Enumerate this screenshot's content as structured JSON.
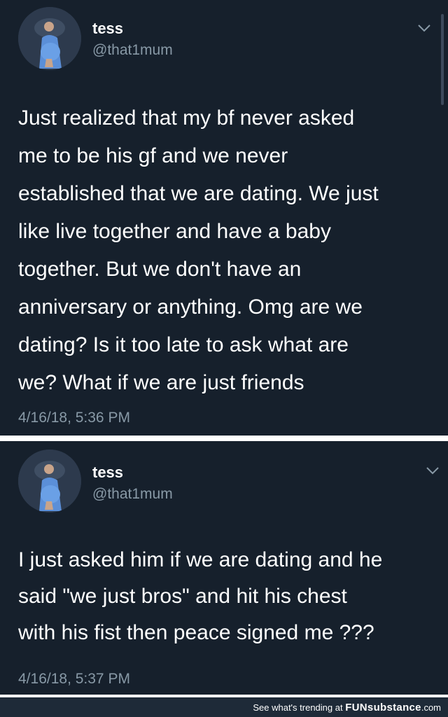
{
  "tweets": [
    {
      "name": "tess",
      "handle": "@that1mum",
      "text": "Just realized that my bf never asked\nme to be his gf and we never\nestablished that we are dating. We just\nlike live together and have a baby\ntogether. But we don't have an\nanniversary or anything. Omg are we\ndating? Is it too late to ask what are\nwe? What if we are just friends",
      "timestamp": "4/16/18, 5:36 PM"
    },
    {
      "name": "tess",
      "handle": "@that1mum",
      "text": "I just asked him if we are dating and he\nsaid \"we just bros\" and hit his chest\nwith his fist then peace signed me ???",
      "timestamp": "4/16/18, 5:37 PM"
    }
  ],
  "footer": {
    "prefix": "See what's trending at ",
    "brand": "FUNsubstance",
    "suffix": ".com"
  },
  "colors": {
    "background": "#16202c",
    "secondary_text": "#8899a6",
    "primary_text": "#ffffff"
  }
}
